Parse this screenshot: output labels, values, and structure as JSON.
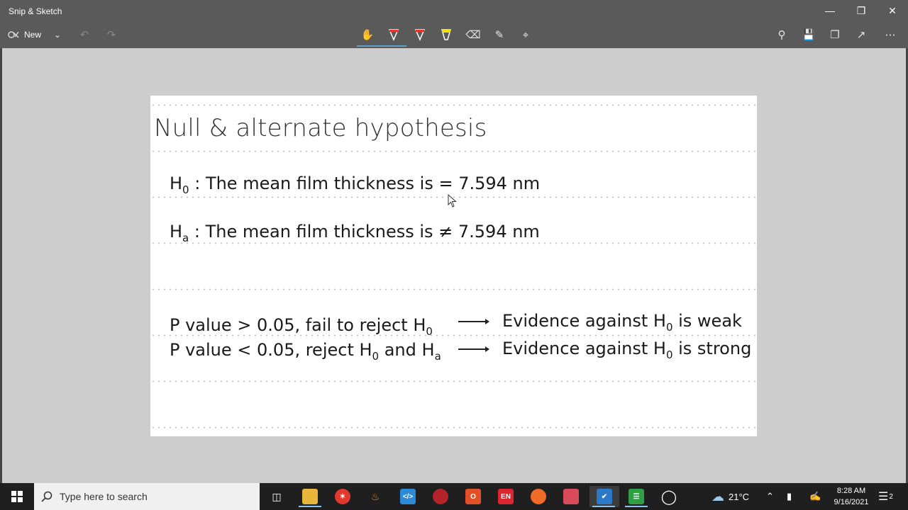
{
  "window": {
    "title": "Snip & Sketch"
  },
  "toolbar": {
    "new_label": "New"
  },
  "slide": {
    "title": "Null & alternate hypothesis",
    "h0_sym": "H",
    "h0_sub": "0",
    "h0_text": " : The mean film thickness is = 7.594 nm",
    "ha_sym": "H",
    "ha_sub": "a",
    "ha_text": " : The mean film thickness is ≠ 7.594 nm",
    "p1_text": "P value > 0.05, fail to reject H",
    "p1_sub": "0",
    "p2_text_a": "P value < 0.05, reject H",
    "p2_sub_a": "0",
    "p2_text_b": " and H",
    "p2_sub_b": "a",
    "e1_a": "Evidence against H",
    "e1_sub": "0",
    "e1_b": " is weak",
    "e2_a": "Evidence against H",
    "e2_sub": "0",
    "e2_b": " is strong"
  },
  "taskbar": {
    "search_placeholder": "Type here to search",
    "weather": "21°C",
    "time": "8:28 AM",
    "date": "9/16/2021",
    "notification_count": "2",
    "lang_badge": "EN"
  }
}
